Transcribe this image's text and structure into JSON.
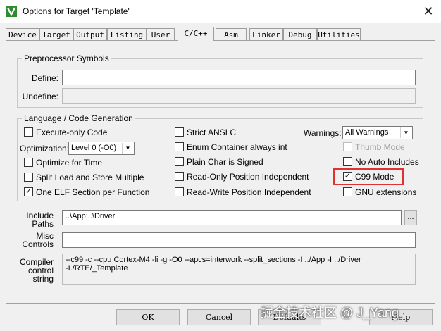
{
  "window": {
    "title": "Options for Target 'Template'",
    "close_glyph": "✕"
  },
  "tabs": [
    {
      "label": "Device"
    },
    {
      "label": "Target"
    },
    {
      "label": "Output"
    },
    {
      "label": "Listing"
    },
    {
      "label": "User"
    },
    {
      "label": "C/C++"
    },
    {
      "label": "Asm"
    },
    {
      "label": "Linker"
    },
    {
      "label": "Debug"
    },
    {
      "label": "Utilities"
    }
  ],
  "active_tab": "C/C++",
  "preprocessor": {
    "title": "Preprocessor Symbols",
    "define_label": "Define:",
    "define_value": "",
    "undefine_label": "Undefine:",
    "undefine_value": ""
  },
  "language": {
    "title": "Language / Code Generation",
    "execute_only": {
      "label": "Execute-only Code",
      "checked": false
    },
    "optimization_label": "Optimization:",
    "optimization_value": "Level 0 (-O0)",
    "optimize_time": {
      "label": "Optimize for Time",
      "checked": false
    },
    "split_load": {
      "label": "Split Load and Store Multiple",
      "checked": false
    },
    "one_elf": {
      "label": "One ELF Section per Function",
      "checked": true,
      "mark": "✓"
    },
    "strict_ansi": {
      "label": "Strict ANSI C",
      "checked": false
    },
    "enum_container": {
      "label": "Enum Container always int",
      "checked": false
    },
    "plain_char": {
      "label": "Plain Char is Signed",
      "checked": false
    },
    "ro_position": {
      "label": "Read-Only Position Independent",
      "checked": false
    },
    "rw_position": {
      "label": "Read-Write Position Independent",
      "checked": false
    },
    "warnings_label": "Warnings:",
    "warnings_value": "All Warnings",
    "thumb_mode": {
      "label": "Thumb Mode",
      "checked": false,
      "disabled": true
    },
    "no_auto_includes": {
      "label": "No Auto Includes",
      "checked": false
    },
    "c99_mode": {
      "label": "C99 Mode",
      "checked": true,
      "mark": "✓"
    },
    "gnu_extensions": {
      "label": "GNU extensions",
      "checked": false
    }
  },
  "include_paths": {
    "label_line1": "Include",
    "label_line2": "Paths",
    "value": "..\\App;..\\Driver",
    "browse_label": "..."
  },
  "misc_controls": {
    "label_line1": "Misc",
    "label_line2": "Controls",
    "value": ""
  },
  "compiler_control": {
    "label_line1": "Compiler",
    "label_line2": "control",
    "label_line3": "string",
    "line1": "--c99 -c --cpu Cortex-M4 -li -g -O0 --apcs=interwork --split_sections -I ../App -I ../Driver",
    "line2": "-I./RTE/_Template"
  },
  "buttons": {
    "ok": "OK",
    "cancel": "Cancel",
    "defaults": "Defaults",
    "help": "Help"
  },
  "colors": {
    "highlight": "#e0322f",
    "app_icon": "#2e8b2e"
  },
  "watermark": "掘金技术社区 @ J_Yang"
}
